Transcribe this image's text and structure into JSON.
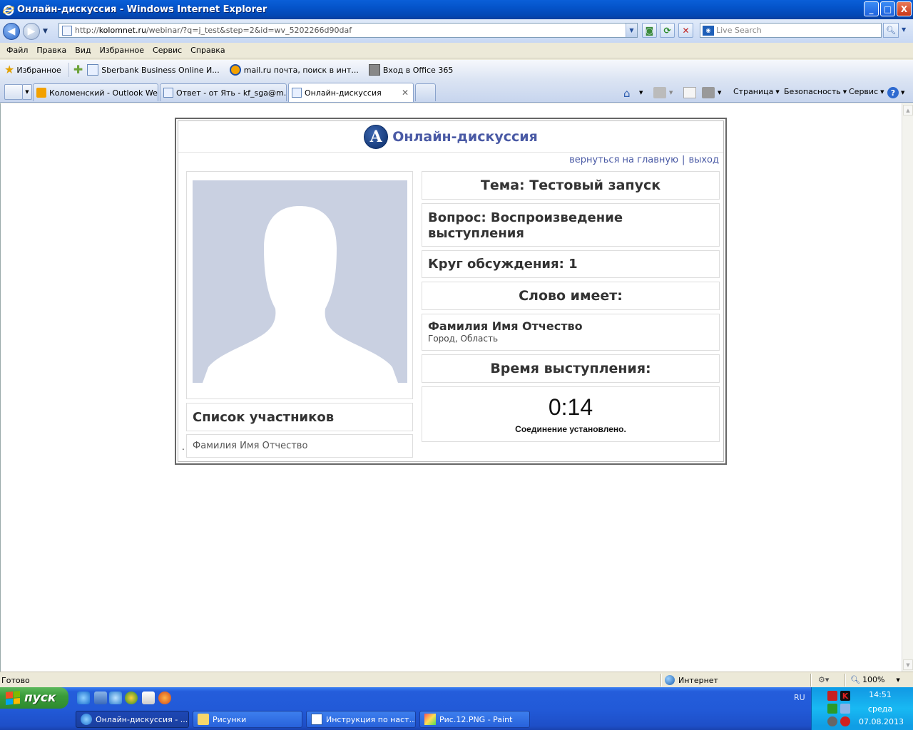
{
  "window": {
    "title": "Онлайн-дискуссия - Windows Internet Explorer",
    "minimize": "_",
    "maximize": "□",
    "close": "X"
  },
  "address": {
    "url_prefix": "http://",
    "url_host": "kolomnet.ru",
    "url_rest": "/webinar/?q=j_test&step=2&id=wv_5202266d90daf",
    "search_placeholder": "Live Search"
  },
  "menu": [
    "Файл",
    "Правка",
    "Вид",
    "Избранное",
    "Сервис",
    "Справка"
  ],
  "favorites": {
    "label": "Избранное",
    "items": [
      "Sberbank Business Online И...",
      "mail.ru почта, поиск в инт...",
      "Вход в Office 365"
    ]
  },
  "tabs": [
    {
      "label": "Коломенский - Outlook Web..."
    },
    {
      "label": "Ответ - от Ять - kf_sga@m..."
    },
    {
      "label": "Онлайн-дискуссия"
    }
  ],
  "commands": {
    "page": "Страница",
    "security": "Безопасность",
    "tools": "Сервис"
  },
  "page": {
    "logo_letter": "А",
    "title": "Онлайн-дискуссия",
    "link_home": "вернуться на главную",
    "link_sep": "|",
    "link_exit": "выход",
    "participants_header": "Список участников",
    "participant_dot": ".",
    "participants": [
      "Фамилия Имя Отчество"
    ],
    "topic": "Тема: Тестовый запуск",
    "question": "Вопрос: Воспроизведение выступления",
    "round": "Круг обсуждения: 1",
    "speaker_header": "Слово имеет:",
    "speaker_name": "Фамилия Имя Отчество",
    "speaker_location": "Город, Область",
    "time_header": "Время выступления:",
    "timer": "0:14",
    "connection_status": "Соединение установлено."
  },
  "status": {
    "ready": "Готово",
    "zone": "Интернет",
    "zoom": "100%"
  },
  "taskbar": {
    "start": "пуск",
    "tasks": [
      "Онлайн-дискуссия - ...",
      "Рисунки",
      "Инструкция по наст...",
      "Рис.12.PNG - Paint"
    ],
    "lang": "RU",
    "time": "14:51",
    "day": "среда",
    "date": "07.08.2013"
  },
  "colors": {
    "accent": "#4a5aa5",
    "avatar_bg": "#c9d0e1"
  }
}
